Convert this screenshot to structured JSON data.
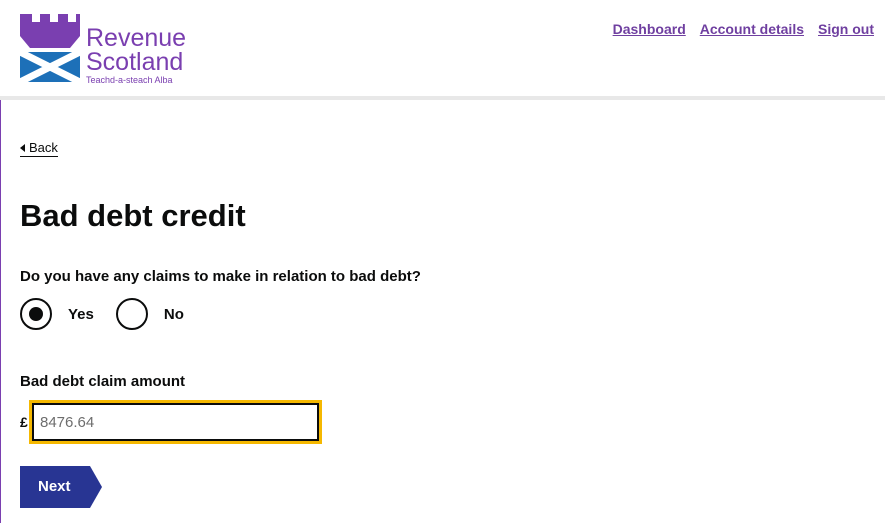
{
  "header": {
    "logo": {
      "line1": "Revenue",
      "line2": "Scotland",
      "line3": "Teachd-a-steach Alba"
    },
    "nav": {
      "dashboard": "Dashboard",
      "account_details": "Account details",
      "sign_out": "Sign out"
    }
  },
  "back_link": "Back",
  "page_title": "Bad debt credit",
  "question": "Do you have any claims to make in relation to bad debt?",
  "radios": [
    {
      "label": "Yes",
      "checked": true
    },
    {
      "label": "No",
      "checked": false
    }
  ],
  "amount_field": {
    "label": "Bad debt claim amount",
    "currency": "£",
    "value": "8476.64"
  },
  "next_button": "Next",
  "colors": {
    "brand_purple": "#7a3fb0",
    "brand_blue": "#1d70b8",
    "button_navy": "#283593",
    "focus_yellow": "#f5b800"
  }
}
